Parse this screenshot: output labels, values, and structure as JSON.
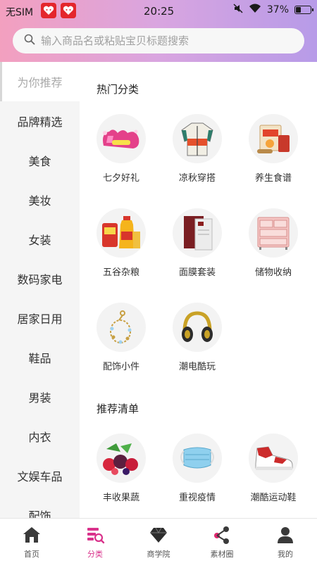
{
  "status": {
    "carrier": "无SIM",
    "time": "20:25",
    "battery": "37%",
    "battery_level": 0.37
  },
  "search": {
    "placeholder": "输入商品名或粘贴宝贝标题搜索"
  },
  "sidebar": {
    "items": [
      {
        "label": "为你推荐",
        "active": true
      },
      {
        "label": "品牌精选"
      },
      {
        "label": "美食"
      },
      {
        "label": "美妆"
      },
      {
        "label": "女装"
      },
      {
        "label": "数码家电"
      },
      {
        "label": "居家日用"
      },
      {
        "label": "鞋品"
      },
      {
        "label": "男装"
      },
      {
        "label": "内衣"
      },
      {
        "label": "文娱车品"
      },
      {
        "label": "配饰"
      }
    ]
  },
  "hot": {
    "title": "热门分类",
    "items": [
      {
        "label": "七夕好礼",
        "icon": "qixi-gift-icon"
      },
      {
        "label": "凉秋穿搭",
        "icon": "jacket-icon"
      },
      {
        "label": "养生食谱",
        "icon": "health-food-icon"
      },
      {
        "label": "五谷杂粮",
        "icon": "grain-oil-icon"
      },
      {
        "label": "面膜套装",
        "icon": "face-mask-icon"
      },
      {
        "label": "储物收纳",
        "icon": "storage-drawer-icon"
      },
      {
        "label": "配饰小件",
        "icon": "bracelet-icon"
      },
      {
        "label": "潮电酷玩",
        "icon": "headphones-icon"
      }
    ]
  },
  "recommend": {
    "title": "推荐清单",
    "items": [
      {
        "label": "丰收果蔬",
        "icon": "fruit-icon"
      },
      {
        "label": "重视疫情",
        "icon": "medical-mask-icon"
      },
      {
        "label": "潮酷运动鞋",
        "icon": "sneaker-icon"
      }
    ]
  },
  "nav": {
    "items": [
      {
        "label": "首页",
        "icon": "home-icon"
      },
      {
        "label": "分类",
        "icon": "category-icon",
        "active": true
      },
      {
        "label": "商学院",
        "icon": "diamond-icon"
      },
      {
        "label": "素材圈",
        "icon": "share-icon"
      },
      {
        "label": "我的",
        "icon": "user-icon"
      }
    ]
  },
  "colors": {
    "accent": "#d9328b",
    "header_start": "#f3a0bf",
    "header_end": "#b79be8"
  }
}
